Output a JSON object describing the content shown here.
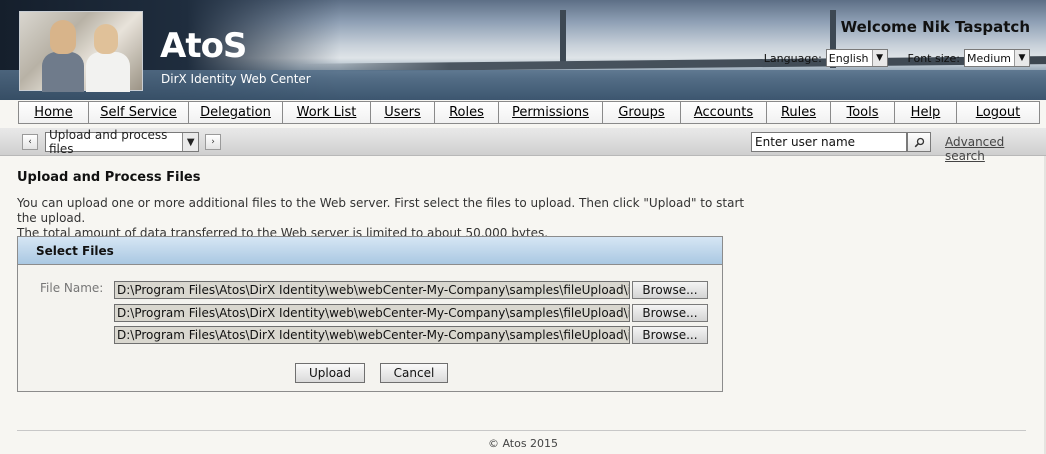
{
  "header": {
    "logo_text": "AtoS",
    "app_subtitle": "DirX Identity Web Center",
    "welcome": "Welcome Nik Taspatch",
    "language_label": "Language:",
    "language_value": "English",
    "fontsize_label": "Font size:",
    "fontsize_value": "Medium"
  },
  "nav": {
    "items": [
      {
        "label": "Home"
      },
      {
        "label": "Self Service"
      },
      {
        "label": "Delegation"
      },
      {
        "label": "Work List"
      },
      {
        "label": "Users"
      },
      {
        "label": "Roles"
      },
      {
        "label": "Permissions"
      },
      {
        "label": "Groups"
      },
      {
        "label": "Accounts"
      },
      {
        "label": "Rules"
      },
      {
        "label": "Tools"
      },
      {
        "label": "Help"
      },
      {
        "label": "Logout"
      }
    ]
  },
  "toolbar": {
    "back_symbol": "‹",
    "forward_symbol": "›",
    "page_select_value": "Upload and process files",
    "user_search_value": "Enter user name",
    "advanced_search": "Advanced search"
  },
  "content": {
    "title": "Upload and Process Files",
    "description_line1": "You can upload one or more additional files to the Web server. First select the files to upload. Then click \"Upload\" to start the upload.",
    "description_line2": "The total amount of data transferred to the Web server is limited to about 50,000 bytes.",
    "panel_title": "Select Files",
    "file_name_label": "File Name:",
    "files": [
      {
        "path": "D:\\Program Files\\Atos\\DirX Identity\\web\\webCenter-My-Company\\samples\\fileUpload\\inputFiles\\",
        "browse": "Browse..."
      },
      {
        "path": "D:\\Program Files\\Atos\\DirX Identity\\web\\webCenter-My-Company\\samples\\fileUpload\\inputFiles\\",
        "browse": "Browse..."
      },
      {
        "path": "D:\\Program Files\\Atos\\DirX Identity\\web\\webCenter-My-Company\\samples\\fileUpload\\inputFiles\\",
        "browse": "Browse..."
      }
    ],
    "upload_label": "Upload",
    "cancel_label": "Cancel"
  },
  "footer": {
    "copyright": "© Atos 2015"
  }
}
